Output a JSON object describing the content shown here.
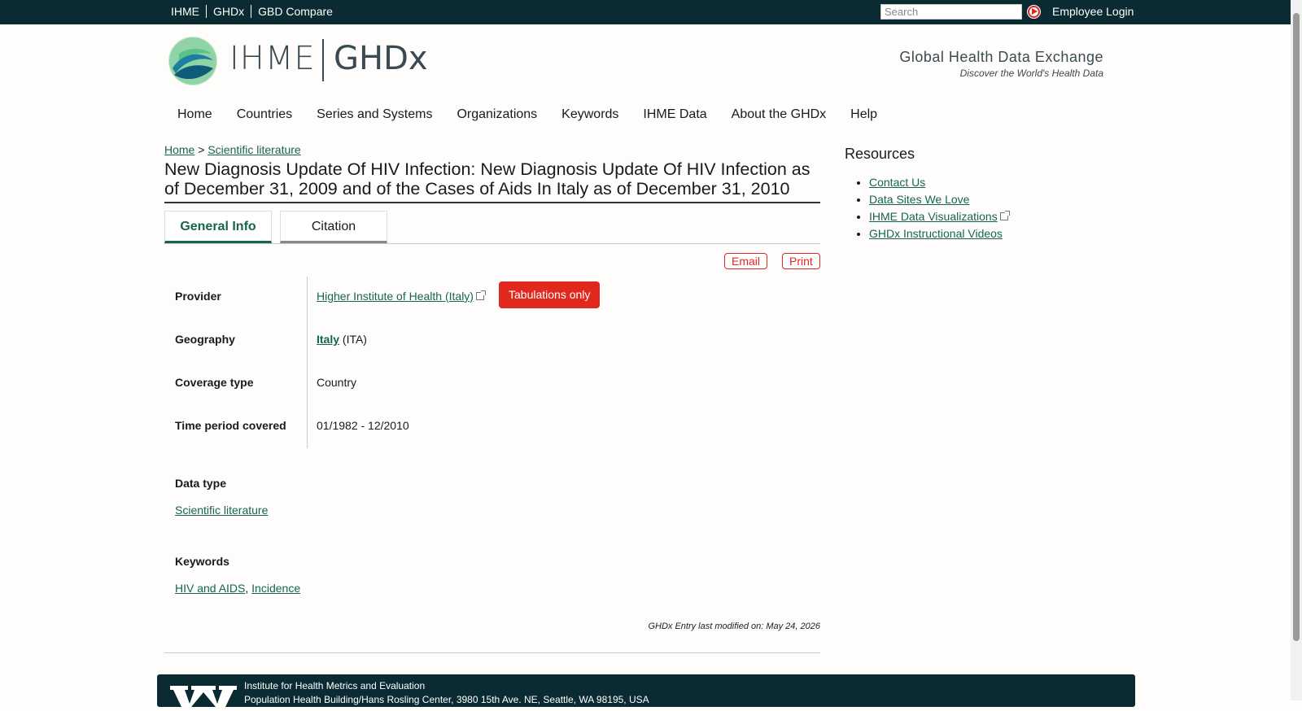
{
  "topbar": {
    "links": [
      "IHME",
      "GHDx",
      "GBD Compare"
    ],
    "search_placeholder": "Search",
    "login": "Employee Login"
  },
  "header": {
    "logo_ihme": "IHME",
    "logo_ghdx": "GHDx",
    "tagline": "Global Health Data Exchange",
    "subtagline": "Discover the World's Health Data"
  },
  "nav": [
    "Home",
    "Countries",
    "Series and Systems",
    "Organizations",
    "Keywords",
    "IHME Data",
    "About the GHDx",
    "Help"
  ],
  "breadcrumb": {
    "home": "Home",
    "sep": ">",
    "current": "Scientific literature"
  },
  "title": "New Diagnosis Update Of HIV Infection: New Diagnosis Update Of HIV Infection as of December 31, 2009 and of the Cases of Aids In Italy as of December 31, 2010",
  "tabs": [
    "General Info",
    "Citation"
  ],
  "actions": {
    "email": "Email",
    "print": "Print"
  },
  "info": {
    "provider_label": "Provider",
    "provider_value": "Higher Institute of Health (Italy)",
    "badge": "Tabulations only",
    "geography_label": "Geography",
    "geography_value": "Italy",
    "geography_code": "(ITA)",
    "coverage_label": "Coverage type",
    "coverage_value": "Country",
    "time_label": "Time period covered",
    "time_value": "01/1982 - 12/2010",
    "datatype_label": "Data type",
    "datatype_value": "Scientific literature",
    "keywords_label": "Keywords",
    "keyword_1": "HIV and AIDS",
    "keyword_sep": ",",
    "keyword_2": "Incidence"
  },
  "modified": "GHDx Entry last modified on: May 24, 2026",
  "resources": {
    "title": "Resources",
    "items": [
      "Contact Us",
      "Data Sites We Love",
      "IHME Data Visualizations",
      "GHDx Instructional Videos"
    ]
  },
  "footer": {
    "org": "Institute for Health Metrics and Evaluation",
    "address": "Population Health Building/Hans Rosling Center, 3980 15th Ave. NE, Seattle, WA 98195, USA"
  },
  "colors": {
    "accent_green": "#15664a",
    "accent_red": "#e0281f",
    "dark_bar": "#0b2b33"
  }
}
